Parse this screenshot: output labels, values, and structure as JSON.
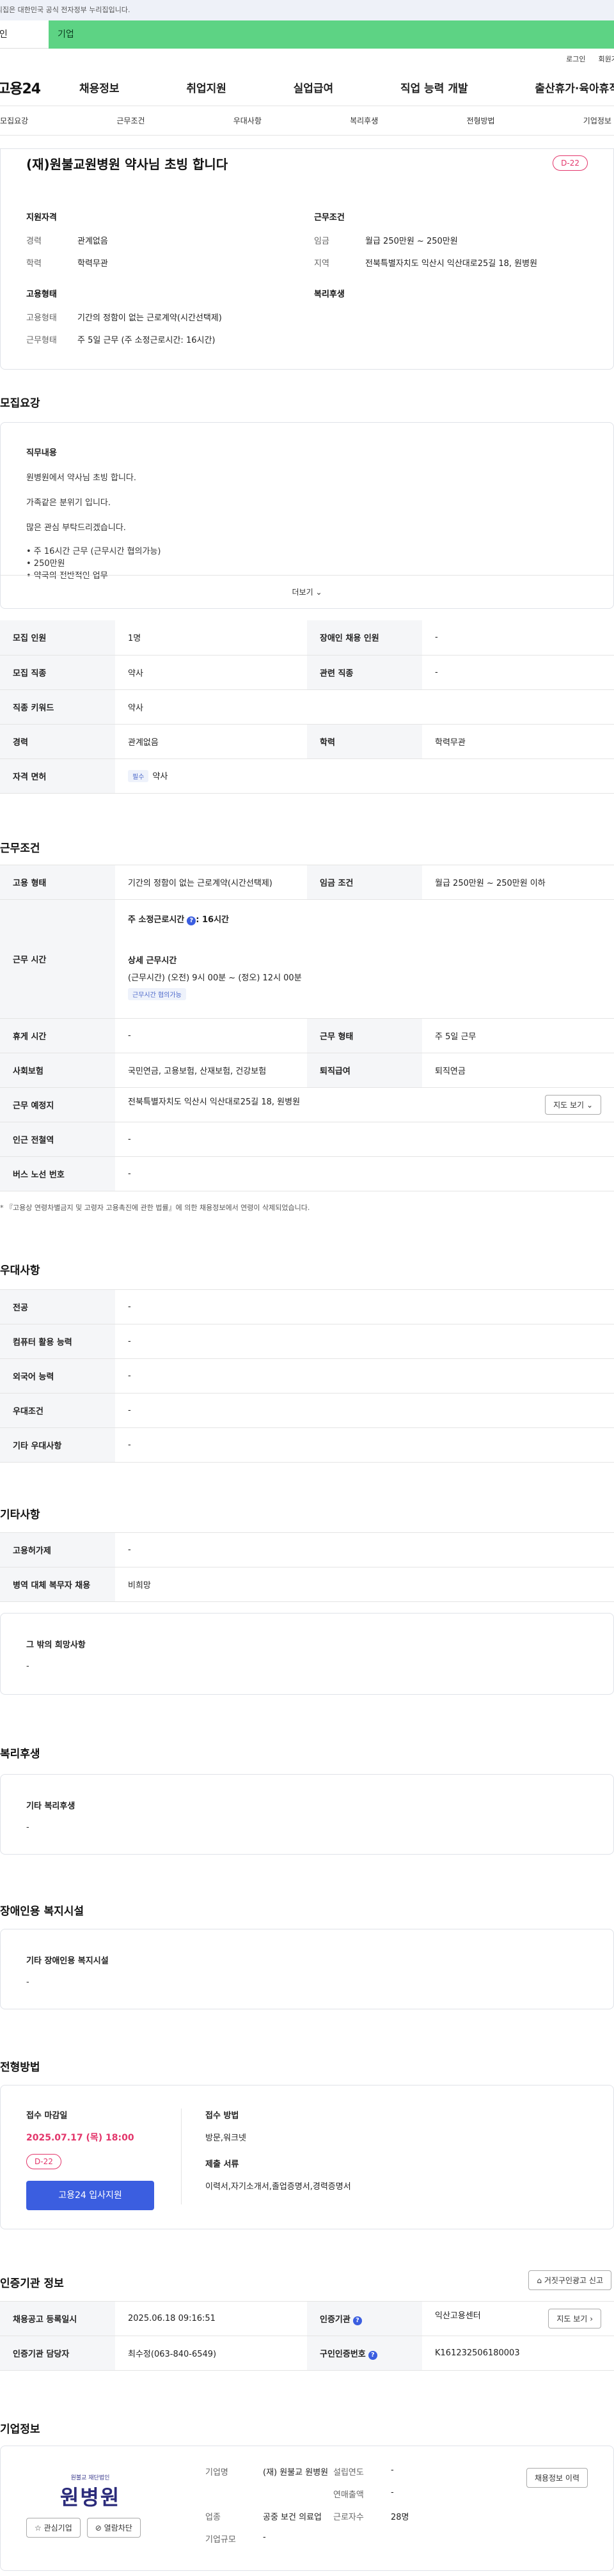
{
  "gov_banner": "이 누리집은 대한민국 공식 전자정부 누리집입니다.",
  "top_tabs": [
    "개인",
    "기업"
  ],
  "util_links": [
    "로그인",
    "회원가입"
  ],
  "logo": "고용24",
  "gnb": [
    "채용정보",
    "취업지원",
    "실업급여",
    "직업 능력 개발",
    "출산휴가·육아휴직"
  ],
  "subnav": [
    "모집요강",
    "근무조건",
    "우대사항",
    "복리후생",
    "전형방법",
    "기업정보"
  ],
  "header": {
    "title": "(재)원불교원병원 약사님 초빙 합니다",
    "dday": "D-22",
    "qual_heading": "지원자격",
    "qual": [
      {
        "k": "경력",
        "v": "관계없음"
      },
      {
        "k": "학력",
        "v": "학력무관"
      }
    ],
    "cond_heading": "근무조건",
    "cond": [
      {
        "k": "임금",
        "v": "월급 250만원 ~ 250만원"
      },
      {
        "k": "지역",
        "v": "전북특별자치도 익산시 익산대로25길 18, 원병원"
      }
    ],
    "emp_heading": "고용형태",
    "emp": [
      {
        "k": "고용형태",
        "v": "기간의 정함이 없는 근로계약(시간선택제)"
      },
      {
        "k": "근무형태",
        "v": "주 5일 근무 (주 소정근로시간: 16시간)"
      }
    ],
    "welfare_heading": "복리후생"
  },
  "recruit": {
    "section_title": "모집요강",
    "duty_title": "직무내용",
    "duty_lines": [
      "원병원에서 약사님 초빙 합니다.",
      "가족같은 분위기 입니다.",
      "많은 관심 부탁드리겠습니다."
    ],
    "duty_bullets": [
      "• 주 16시간 근무 (근무시간 협의가능)",
      "• 250만원",
      "• 약국의 전반적인 업무"
    ],
    "more_label": "더보기",
    "rows": [
      {
        "k1": "모집 인원",
        "v1": "1명",
        "k2": "장애인 채용 인원",
        "v2": "-"
      },
      {
        "k1": "모집 직종",
        "v1": "약사",
        "k2": "관련 직종",
        "v2": "-"
      },
      {
        "k1": "직종 키워드",
        "v1": "약사"
      },
      {
        "k1": "경력",
        "v1": "관계없음",
        "k2": "학력",
        "v2": "학력무관"
      },
      {
        "k1": "자격 면허",
        "chip": "필수",
        "v1": "약사"
      }
    ]
  },
  "work": {
    "section_title": "근무조건",
    "emp_type_k": "고용 형태",
    "emp_type_v": "기간의 정함이 없는 근로계약(시간선택제)",
    "wage_k": "임금 조건",
    "wage_v": "월급 250만원 ~ 250만원 이하",
    "hours_k": "근무 시간",
    "hours_weekly_label": "주 소정근로시간",
    "hours_weekly_value": ": 16시간",
    "hours_detail_label": "상세 근무시간",
    "hours_detail_value": "(근무시간) (오전) 9시 00분 ~ (정오) 12시 00분",
    "hours_chip": "근무시간 협의가능",
    "rest_k": "휴게 시간",
    "rest_v": "-",
    "form_k": "근무 형태",
    "form_v": "주 5일 근무",
    "ins_k": "사회보험",
    "ins_v": "국민연금, 고용보험, 산재보험, 건강보험",
    "ret_k": "퇴직급여",
    "ret_v": "퇴직연금",
    "place_k": "근무 예정지",
    "place_v": "전북특별자치도 익산시 익산대로25길 18, 원병원",
    "map_btn": "지도 보기",
    "subway_k": "인근 전철역",
    "subway_v": "-",
    "bus_k": "버스 노선 번호",
    "bus_v": "-",
    "note": "* 『고용상 연령차별금지 및 고령자 고용촉진에 관한 법률』에 의한 채용정보에서 연령이 삭제되었습니다."
  },
  "pref": {
    "section_title": "우대사항",
    "rows": [
      {
        "k": "전공",
        "v": "-"
      },
      {
        "k": "컴퓨터 활용 능력",
        "v": "-"
      },
      {
        "k": "외국어 능력",
        "v": "-"
      },
      {
        "k": "우대조건",
        "v": "-"
      },
      {
        "k": "기타 우대사항",
        "v": "-"
      }
    ]
  },
  "etc": {
    "section_title": "기타사항",
    "rows": [
      {
        "k": "고용허가제",
        "v": "-"
      },
      {
        "k": "병역 대체 복무자 채용",
        "v": "비희망"
      }
    ],
    "other_title": "그 밖의 희망사항",
    "other_value": "-"
  },
  "welfare": {
    "section_title": "복리후생",
    "box_title": "기타 복리후생",
    "box_value": "-"
  },
  "disabled": {
    "section_title": "장애인용 복지시설",
    "box_title": "기타 장애인용 복지시설",
    "box_value": "-"
  },
  "selection": {
    "section_title": "전형방법",
    "deadline_h": "접수 마감일",
    "deadline": "2025.07.17 (목) 18:00",
    "dday": "D-22",
    "apply_btn": "고용24 입사지원",
    "method_h": "접수 방법",
    "method_v": "방문,워크넷",
    "docs_h": "제출 서류",
    "docs_v": "이력서,자기소개서,졸업증명서,경력증명서"
  },
  "cert": {
    "section_title": "인증기관 정보",
    "report_btn": "거짓구인광고 신고",
    "reg_k": "채용공고 등록일시",
    "reg_v": "2025.06.18 09:16:51",
    "org_k": "인증기관",
    "org_v": "익산고용센터",
    "map_btn": "지도 보기",
    "mgr_k": "인증기관 담당자",
    "mgr_v": "최수정(063-840-6549)",
    "id_k": "구인인증번호",
    "id_v": "K161232506180003"
  },
  "company": {
    "section_title": "기업정보",
    "logo_sub": "원불교 재단법인",
    "logo_main": "원병원",
    "fav_btn": "관심기업",
    "block_btn": "열람차단",
    "history_btn": "채용정보 이력",
    "name_k": "기업명",
    "name_v": "(재) 원불교 원병원",
    "year_k": "설립연도",
    "year_v": "-",
    "sales_k": "연매출액",
    "sales_v": "-",
    "ind_k": "업종",
    "ind_v": "공중 보건 의료업",
    "emp_k": "근로자수",
    "emp_v": "28명",
    "size_k": "기업규모",
    "size_v": "-"
  }
}
